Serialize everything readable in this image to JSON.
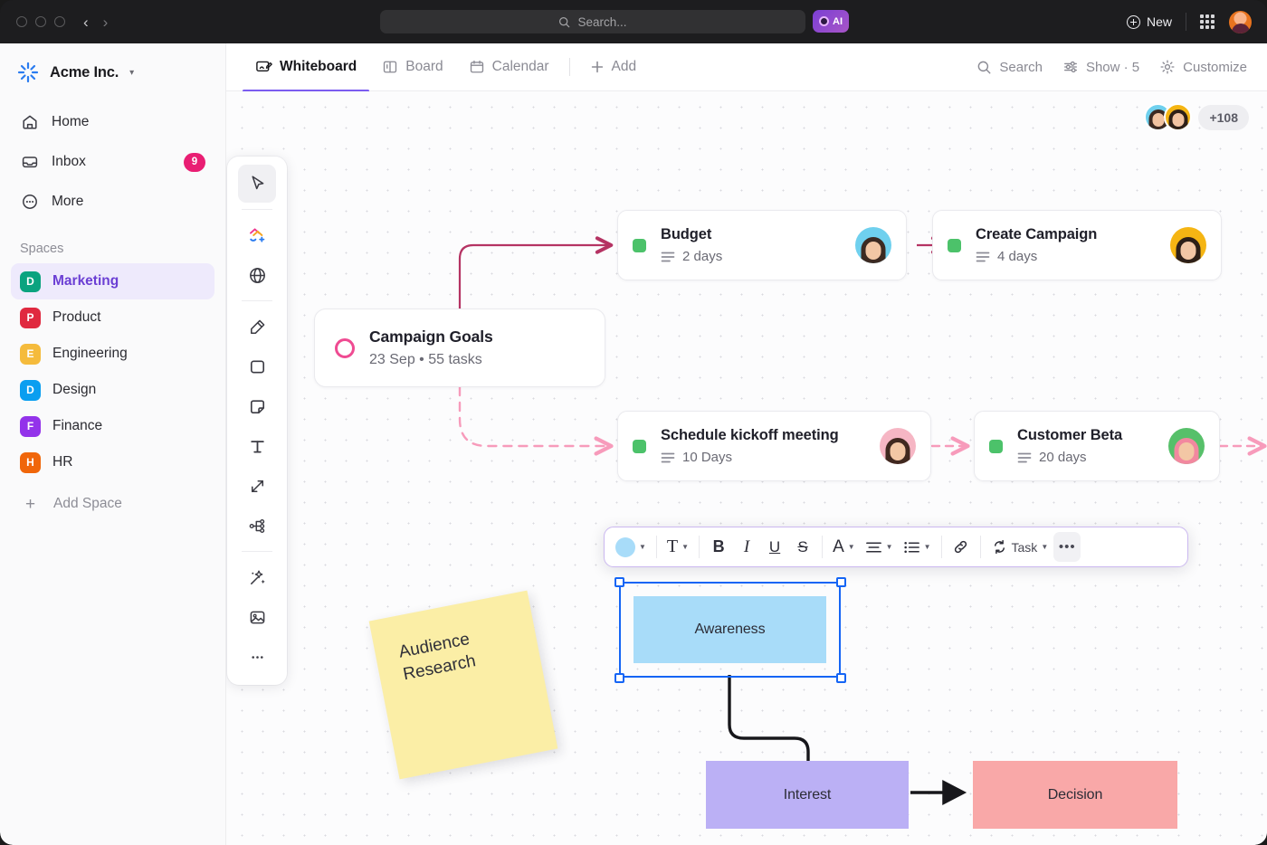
{
  "window": {
    "nav_back": "‹",
    "nav_forward": "›"
  },
  "topbar": {
    "search_placeholder": "Search...",
    "ai_label": "AI",
    "new_label": "New"
  },
  "sidebar": {
    "workspace_name": "Acme Inc.",
    "nav": [
      {
        "label": "Home",
        "icon": "home-icon"
      },
      {
        "label": "Inbox",
        "icon": "inbox-icon",
        "badge": "9"
      },
      {
        "label": "More",
        "icon": "more-dots-icon"
      }
    ],
    "spaces_label": "Spaces",
    "spaces": [
      {
        "label": "Marketing",
        "initial": "D",
        "color": "#0ba37f",
        "active": true
      },
      {
        "label": "Product",
        "initial": "P",
        "color": "#e0293f",
        "active": false
      },
      {
        "label": "Engineering",
        "initial": "E",
        "color": "#f5bb3c",
        "active": false
      },
      {
        "label": "Design",
        "initial": "D",
        "color": "#0a9ef0",
        "active": false
      },
      {
        "label": "Finance",
        "initial": "F",
        "color": "#9333ea",
        "active": false
      },
      {
        "label": "HR",
        "initial": "H",
        "color": "#f0660a",
        "active": false
      }
    ],
    "add_space_label": "Add Space"
  },
  "tabs": [
    {
      "label": "Whiteboard",
      "icon": "whiteboard-icon",
      "active": true
    },
    {
      "label": "Board",
      "icon": "board-icon",
      "active": false
    },
    {
      "label": "Calendar",
      "icon": "calendar-icon",
      "active": false
    },
    {
      "label": "Add",
      "icon": "plus-icon",
      "active": false
    }
  ],
  "tab_actions": [
    {
      "label": "Search",
      "icon": "search-icon"
    },
    {
      "label": "Show · 5",
      "icon": "sliders-icon"
    },
    {
      "label": "Customize",
      "icon": "gear-icon"
    }
  ],
  "collaborators": {
    "overflow_label": "+108"
  },
  "whiteboard_tools": [
    {
      "name": "select-tool",
      "active": true
    },
    {
      "name": "shapes-add-tool",
      "active": false
    },
    {
      "name": "globe-tool",
      "active": false
    },
    {
      "name": "pen-tool",
      "active": false
    },
    {
      "name": "rectangle-tool",
      "active": false
    },
    {
      "name": "sticky-note-tool",
      "active": false
    },
    {
      "name": "text-tool",
      "active": false
    },
    {
      "name": "connector-tool",
      "active": false
    },
    {
      "name": "mindmap-tool",
      "active": false
    },
    {
      "name": "ai-magic-tool",
      "active": false
    },
    {
      "name": "image-tool",
      "active": false
    },
    {
      "name": "more-tools",
      "active": false
    }
  ],
  "canvas": {
    "goal_card": {
      "title": "Campaign Goals",
      "meta": "23 Sep • 55 tasks",
      "ring_color": "#ef4b92"
    },
    "task_cards": [
      {
        "title": "Budget",
        "duration": "2 days",
        "status_color": "#4cc26a",
        "avatar_bg": "#6fd0ee",
        "avatar_hair": "#3c2a22"
      },
      {
        "title": "Create Campaign",
        "duration": "4 days",
        "status_color": "#4cc26a",
        "avatar_bg": "#f5b513",
        "avatar_hair": "#2e2018"
      },
      {
        "title": "Schedule kickoff meeting",
        "duration": "10 Days",
        "status_color": "#4cc26a",
        "avatar_bg": "#f6b6c4",
        "avatar_hair": "#40281f"
      },
      {
        "title": "Customer Beta",
        "duration": "20 days",
        "status_color": "#4cc26a",
        "avatar_bg": "#57c06a",
        "avatar_hair": "#f2889f"
      }
    ],
    "sticky_note": {
      "line1": "Audience",
      "line2": "Research",
      "color": "#fbeea6"
    },
    "flow_shapes": [
      {
        "label": "Awareness",
        "color": "#a8dcf9",
        "selected": true
      },
      {
        "label": "Interest",
        "color": "#bbb0f5",
        "selected": false
      },
      {
        "label": "Decision",
        "color": "#f9a8a8",
        "selected": false
      }
    ]
  },
  "format_toolbar": {
    "fill_color": "#a8dcf9",
    "buttons": [
      {
        "name": "fill-color-button",
        "label": ""
      },
      {
        "name": "text-style-button",
        "label": "T"
      },
      {
        "name": "bold-button",
        "label": "B"
      },
      {
        "name": "italic-button",
        "label": "I"
      },
      {
        "name": "underline-button",
        "label": "U"
      },
      {
        "name": "strikethrough-button",
        "label": "S"
      },
      {
        "name": "font-color-button",
        "label": "A"
      },
      {
        "name": "align-button",
        "label": ""
      },
      {
        "name": "list-button",
        "label": ""
      },
      {
        "name": "link-button",
        "label": ""
      }
    ],
    "task_label": "Task",
    "more_label": "•••"
  }
}
